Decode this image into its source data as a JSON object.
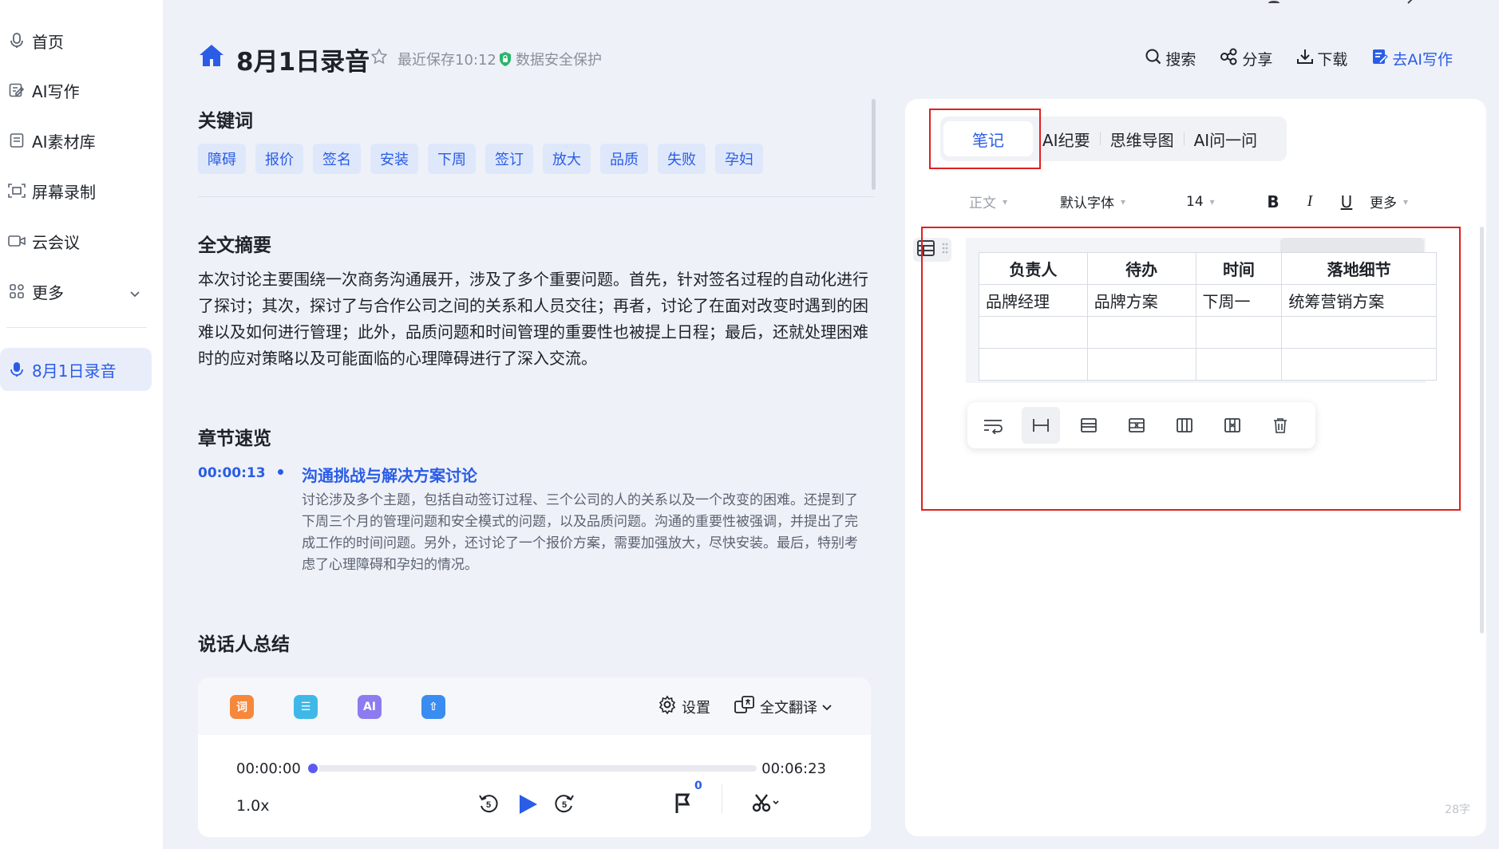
{
  "sidebar": {
    "items": [
      {
        "label": "首页",
        "icon": "mic-icon"
      },
      {
        "label": "AI写作",
        "icon": "edit-icon"
      },
      {
        "label": "AI素材库",
        "icon": "library-icon"
      },
      {
        "label": "屏幕录制",
        "icon": "screen-record-icon"
      },
      {
        "label": "云会议",
        "icon": "video-icon"
      },
      {
        "label": "更多",
        "icon": "grid-icon"
      }
    ],
    "active_recording": "8月1日录音"
  },
  "header": {
    "title": "8月1日录音",
    "save_time": "最近保存10:12",
    "secure_label": "数据安全保护",
    "actions": {
      "search": "搜索",
      "share": "分享",
      "download": "下载",
      "ai_write": "去AI写作"
    }
  },
  "keywords": {
    "title": "关键词",
    "tags": [
      "障碍",
      "报价",
      "签名",
      "安装",
      "下周",
      "签订",
      "放大",
      "品质",
      "失败",
      "孕妇"
    ]
  },
  "summary": {
    "title": "全文摘要",
    "text": "本次讨论主要围绕一次商务沟通展开，涉及了多个重要问题。首先，针对签名过程的自动化进行了探讨；其次，探讨了与合作公司之间的关系和人员交往；再者，讨论了在面对改变时遇到的困难以及如何进行管理；此外，品质问题和时间管理的重要性也被提上日程；最后，还就处理困难时的应对策略以及可能面临的心理障碍进行了深入交流。"
  },
  "chapters": {
    "title": "章节速览",
    "items": [
      {
        "time": "00:00:13",
        "title": "沟通挑战与解决方案讨论",
        "desc": "讨论涉及多个主题，包括自动签订过程、三个公司的人的关系以及一个改变的困难。还提到了下周三个月的管理问题和安全模式的问题，以及品质问题。沟通的重要性被强调，并提出了完成工作的时间问题。另外，还讨论了一个报价方案，需要加强放大，尽快安装。最后，特别考虑了心理障碍和孕妇的情况。"
      }
    ]
  },
  "speakers": {
    "title": "说话人总结"
  },
  "player": {
    "tools": [
      {
        "label": "词",
        "color": "#f7873a"
      },
      {
        "label": "☰",
        "color": "#3fb8e8"
      },
      {
        "label": "AI",
        "color": "#8b7cf0"
      },
      {
        "label": "⇧",
        "color": "#3a8cf0"
      }
    ],
    "settings": "设置",
    "translate": "全文翻译",
    "current_time": "00:00:00",
    "total_time": "00:06:23",
    "progress": 0.0,
    "speed": "1.0x",
    "flag_count": "0"
  },
  "notes": {
    "tabs": [
      "笔记",
      "AI纪要",
      "思维导图",
      "AI问一问"
    ],
    "active_tab": 0,
    "format": {
      "style": "正文",
      "font": "默认字体",
      "size": "14",
      "more": "更多",
      "bold": "B",
      "italic": "I",
      "underline": "U"
    },
    "table": {
      "headers": [
        "负责人",
        "待办",
        "时间",
        "落地细节"
      ],
      "rows": [
        [
          "品牌经理",
          "品牌方案",
          "下周一",
          "统筹营销方案"
        ],
        [
          "",
          "",
          "",
          ""
        ],
        [
          "",
          "",
          "",
          ""
        ]
      ]
    },
    "word_count": "28字"
  },
  "colors": {
    "accent": "#2a5ce6",
    "highlight": "#e02020",
    "progress": "#5b5bf0"
  }
}
